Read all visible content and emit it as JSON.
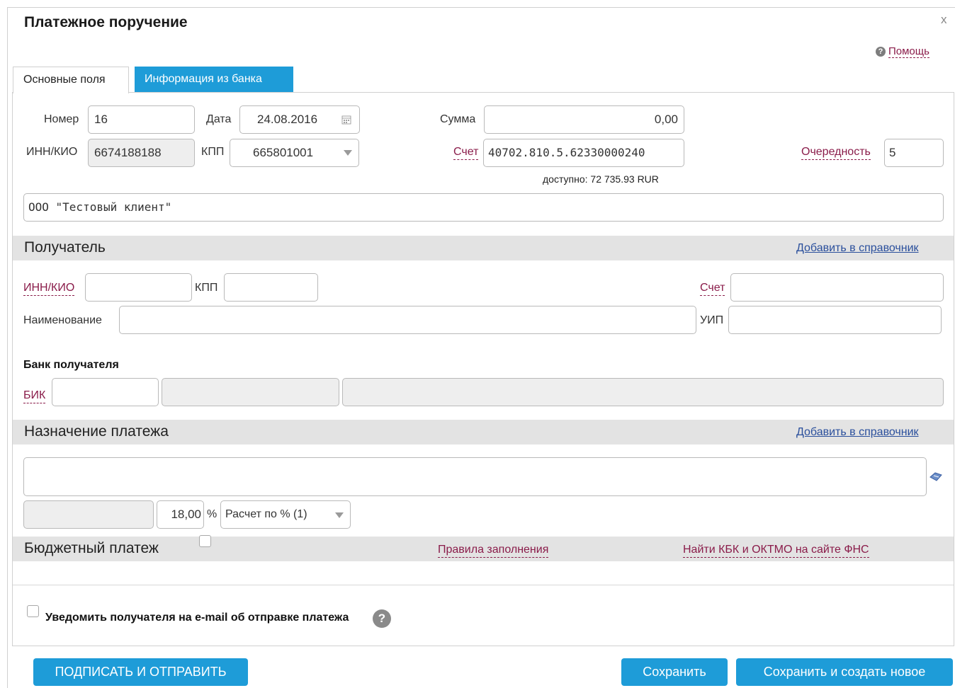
{
  "dialog": {
    "title": "Платежное поручение",
    "close": "x",
    "help": "Помощь"
  },
  "tabs": {
    "main": "Основные поля",
    "bank": "Информация из банка"
  },
  "payer": {
    "number_label": "Номер",
    "number": "16",
    "date_label": "Дата",
    "date": "24.08.2016",
    "sum_label": "Сумма",
    "sum": "0,00",
    "inn_label": "ИНН/КИО",
    "inn": "6674188188",
    "kpp_label": "КПП",
    "kpp": "665801001",
    "account_label": "Счет",
    "account": "40702.810.5.62330000240",
    "available": "доступно: 72 735.93 RUR",
    "priority_label": "Очередность",
    "priority": "5",
    "name": "ООО \"Тестовый клиент\""
  },
  "recipient": {
    "title": "Получатель",
    "add_link": "Добавить в справочник",
    "inn_label": "ИНН/КИО",
    "kpp_label": "КПП",
    "account_label": "Счет",
    "name_label": "Наименование",
    "uip_label": "УИП",
    "bank_title": "Банк получателя",
    "bik_label": "БИК"
  },
  "purpose": {
    "title": "Назначение платежа",
    "add_link": "Добавить в справочник",
    "vat_rate": "18,00",
    "percent": "%",
    "calc_mode": "Расчет по % (1)"
  },
  "budget": {
    "title": "Бюджетный платеж",
    "rules_link": "Правила заполнения",
    "kbk_link": "Найти КБК и ОКТМО на сайте ФНС"
  },
  "notify": {
    "label": "Уведомить получателя на e-mail об отправке платежа",
    "help": "?"
  },
  "buttons": {
    "sign_send": "ПОДПИСАТЬ И ОТПРАВИТЬ",
    "save": "Сохранить",
    "save_new": "Сохранить и создать новое"
  },
  "colors": {
    "accent": "#1e9cd8",
    "required": "#8a1c4a",
    "link": "#2a4f9c",
    "section_bg": "#e3e3e3"
  }
}
